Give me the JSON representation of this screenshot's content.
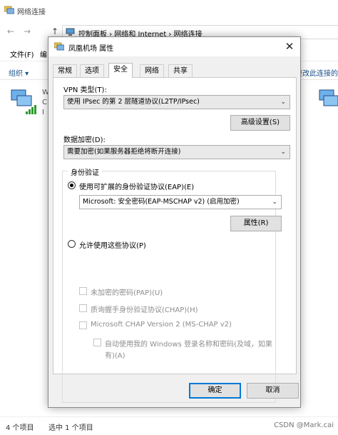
{
  "explorer": {
    "title": "网络连接",
    "breadcrumb": "控制面板  ›  网络和 Internet  ›  网络连接",
    "menu": {
      "file": "文件(F)",
      "edit_partial": "编"
    },
    "organize": "组织",
    "right_cmd": "更改此连接的",
    "left_partial_letters": [
      "W",
      "C",
      "I"
    ],
    "status": {
      "count": "4 个项目",
      "selected": "选中 1 个项目"
    },
    "watermark": "CSDN @Mark.cai"
  },
  "dialog": {
    "title": "凤凰机场 属性",
    "close": "✕",
    "tabs": [
      "常规",
      "选项",
      "安全",
      "网络",
      "共享"
    ],
    "active_tab": "安全",
    "vpn_type_label": "VPN 类型(T):",
    "vpn_type_value": "使用 IPsec 的第 2 层隧道协议(L2TP/IPsec)",
    "advanced_button": "高级设置(S)",
    "encryption_label": "数据加密(D):",
    "encryption_value": "需要加密(如果服务器拒绝将断开连接)",
    "auth_group_title": "身份验证",
    "eap_radio_label": "使用可扩展的身份验证协议(EAP)(E)",
    "eap_value": "Microsoft: 安全密码(EAP-MSCHAP v2) (启用加密)",
    "properties_button": "属性(R)",
    "allow_protocols_label": "允许使用这些协议(P)",
    "checkboxes": {
      "pap": "未加密的密码(PAP)(U)",
      "chap": "质询握手身份验证协议(CHAP)(H)",
      "mschap": "Microsoft CHAP Version 2 (MS-CHAP v2)",
      "auto_login_line1": "自动使用我的 Windows 登录名称和密码(及域，如果",
      "auto_login_line2": "有)(A)"
    },
    "ok_button": "确定",
    "cancel_button": "取消"
  },
  "colors": {
    "accent": "#0078d7",
    "link": "#1a4e8a"
  },
  "icons": [
    "network-connections-icon",
    "back-arrow-icon",
    "forward-arrow-icon",
    "up-arrow-icon",
    "computer-icon",
    "network-adapter-icon",
    "close-icon",
    "chevron-down-icon"
  ]
}
